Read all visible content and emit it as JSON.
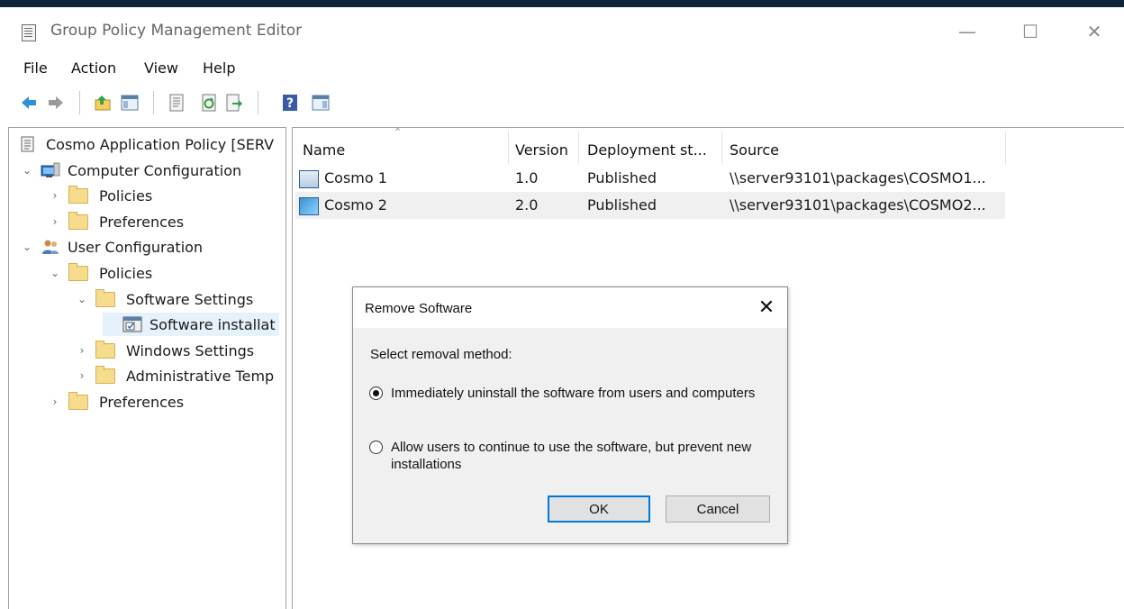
{
  "window": {
    "title": "Group Policy Management Editor",
    "controls": {
      "minimize": "—",
      "maximize": "☐",
      "close": "✕"
    }
  },
  "menu": {
    "items": [
      "File",
      "Action",
      "View",
      "Help"
    ]
  },
  "toolbar": {
    "icons": [
      "back-icon",
      "forward-icon",
      "up-folder-icon",
      "show-hide-console-tree-icon",
      "properties-icon",
      "refresh-icon",
      "export-list-icon",
      "help-icon",
      "show-action-pane-icon"
    ]
  },
  "tree": {
    "root": "Cosmo Application Policy [SERV",
    "computer_config": "Computer Configuration",
    "computer_policies": "Policies",
    "computer_preferences": "Preferences",
    "user_config": "User Configuration",
    "user_policies": "Policies",
    "software_settings": "Software Settings",
    "software_installation": "Software installat",
    "windows_settings": "Windows Settings",
    "admin_templates": "Administrative Temp",
    "user_preferences": "Preferences"
  },
  "list": {
    "columns": [
      "Name",
      "Version",
      "Deployment st...",
      "Source"
    ],
    "rows": [
      {
        "name": "Cosmo 1",
        "version": "1.0",
        "deployment": "Published",
        "source": "\\\\server93101\\packages\\COSMO1..."
      },
      {
        "name": "Cosmo 2",
        "version": "2.0",
        "deployment": "Published",
        "source": "\\\\server93101\\packages\\COSMO2..."
      }
    ]
  },
  "dialog": {
    "title": "Remove Software",
    "close": "✕",
    "prompt": "Select removal method:",
    "option1": "Immediately uninstall the software from users and computers",
    "option2": "Allow users to continue to use the software, but prevent new installations",
    "ok": "OK",
    "cancel": "Cancel"
  }
}
